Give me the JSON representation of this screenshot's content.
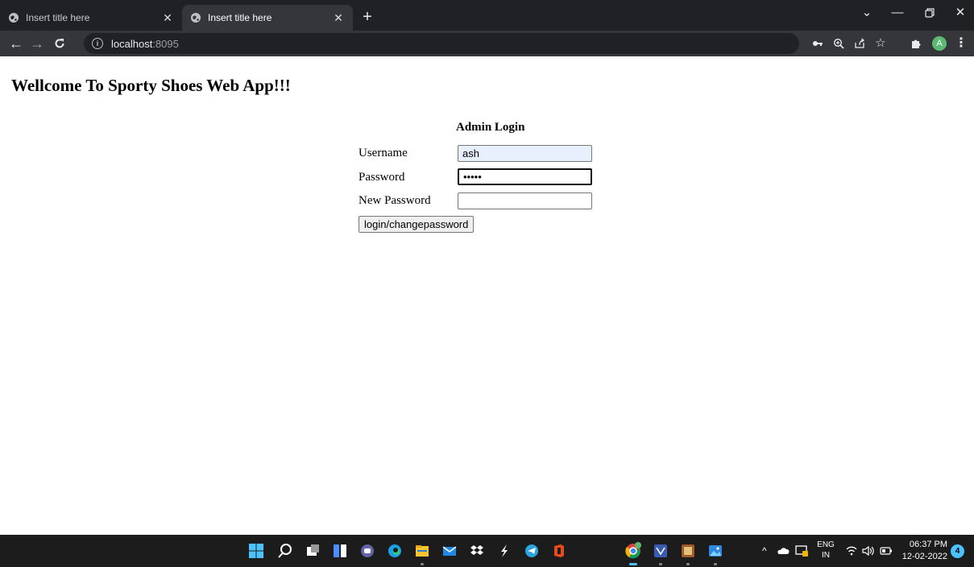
{
  "browser": {
    "tabs": [
      {
        "title": "Insert title here",
        "active": false
      },
      {
        "title": "Insert title here",
        "active": true
      }
    ],
    "new_tab_label": "+",
    "url_host": "localhost",
    "url_port": ":8095"
  },
  "page": {
    "heading": "Wellcome To Sporty Shoes Web App!!!",
    "form_title": "Admin Login",
    "fields": [
      {
        "label": "Username",
        "value": "ash",
        "type": "text"
      },
      {
        "label": "Password",
        "value": "12345",
        "type": "password"
      },
      {
        "label": "New Password",
        "value": "",
        "type": "password"
      }
    ],
    "submit_label": "login/changepassword"
  },
  "profile": {
    "initial": "A"
  },
  "taskbar": {
    "language_top": "ENG",
    "language_bottom": "IN",
    "time": "06:37 PM",
    "date": "12-02-2022",
    "notification_count": "4"
  },
  "colors": {
    "tab_strip": "#202124",
    "toolbar": "#35363a",
    "autofill": "#e8f0fe",
    "accent": "#4cc2ff"
  }
}
